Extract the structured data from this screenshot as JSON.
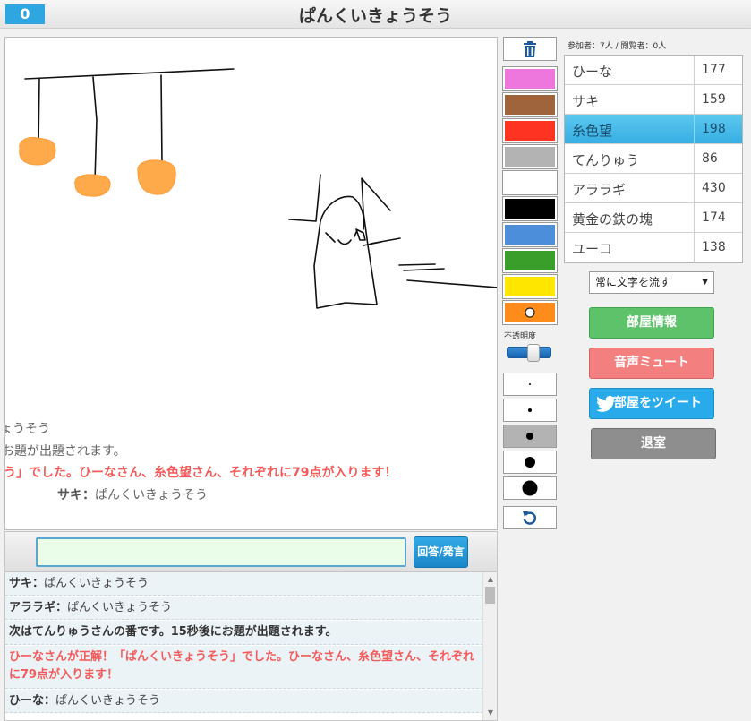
{
  "header": {
    "score": "0",
    "title": "ぱんくいきょうそう"
  },
  "canvas_overlay": [
    {
      "text": "ょうそう"
    },
    {
      "text": "お題が出題されます。"
    },
    {
      "text": "う」でした。ひーなさん、糸色望さん、それぞれに79点が入ります！"
    },
    {
      "name": "サキ：",
      "text": "ぱんくいきょうそう"
    }
  ],
  "answer": {
    "placeholder": "",
    "value": "",
    "button_label": "回答/発言"
  },
  "chat": [
    {
      "name": "サキ：",
      "text": "ぱんくいきょうそう",
      "style": "user"
    },
    {
      "name": "アララギ：",
      "text": "ぱんくいきょうそう",
      "style": "user"
    },
    {
      "name": "",
      "text": "次はてんりゅうさんの番です。15秒後にお題が出題されます。",
      "style": "plain"
    },
    {
      "name": "",
      "text": "ひーなさんが正解！「ぱんくいきょうそう」でした。ひーなさん、糸色望さん、それぞれに79点が入ります！",
      "style": "red"
    },
    {
      "name": "ひーな：",
      "text": "ぱんくいきょうそう",
      "style": "user"
    }
  ],
  "tools": {
    "colors": [
      "#ee77dd",
      "#a0643c",
      "#ff3322",
      "#b3b3b3",
      "#ffffff",
      "#000000",
      "#4c8ed9",
      "#3a9e2a",
      "#ffe600",
      "#ff8c1a"
    ],
    "opacity_label": "不透明度",
    "opacity_value": 0.6,
    "trash_icon": "trash-icon",
    "undo_icon": "undo-icon"
  },
  "participants": {
    "label": "参加者：7人 / 閲覧者：0人",
    "players": [
      {
        "name": "ひーな",
        "score": "177",
        "active": false
      },
      {
        "name": "サキ",
        "score": "159",
        "active": false
      },
      {
        "name": "糸色望",
        "score": "198",
        "active": true
      },
      {
        "name": "てんりゅう",
        "score": "86",
        "active": false
      },
      {
        "name": "アララギ",
        "score": "430",
        "active": false
      },
      {
        "name": "黄金の鉄の塊",
        "score": "174",
        "active": false
      },
      {
        "name": "ユーコ",
        "score": "138",
        "active": false
      }
    ]
  },
  "controls": {
    "scroll_mode": "常に文字を流す",
    "room_info": "部屋情報",
    "mute": "音声ミュート",
    "tweet": "部屋をツイート",
    "exit": "退室"
  }
}
